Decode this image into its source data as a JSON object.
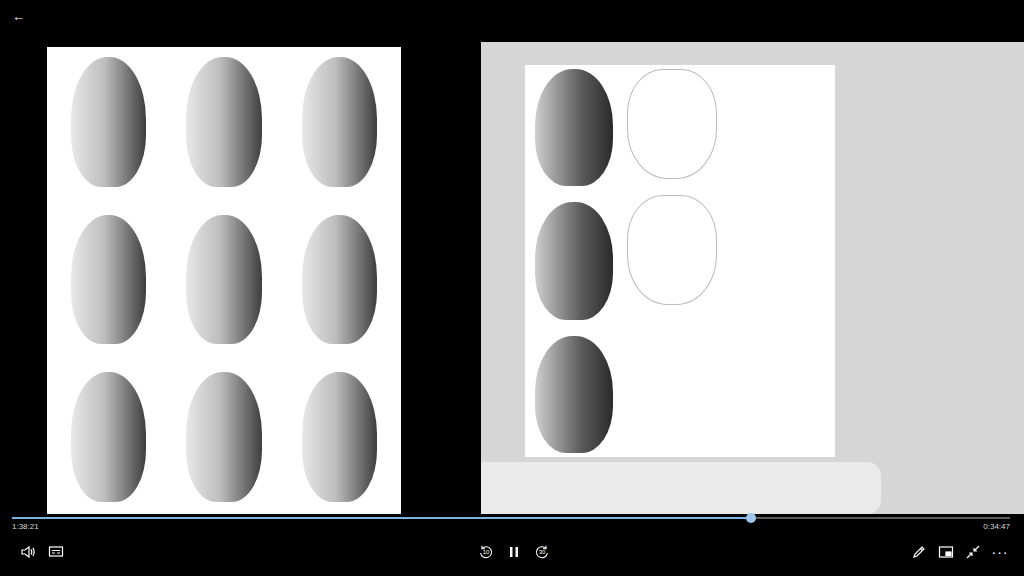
{
  "back": "←",
  "video": {
    "playing": true
  },
  "progress": {
    "level": 0.74,
    "elapsed": "1:38:21",
    "remaining": "0:34:47"
  },
  "controls": {
    "rewind": "10",
    "forward": "30",
    "more": "···"
  }
}
